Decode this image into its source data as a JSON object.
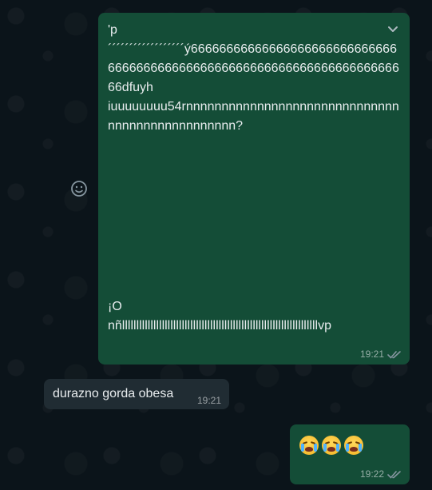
{
  "messages": [
    {
      "direction": "outgoing",
      "text_top": "'p\n´´´´´´´´´´´´´´´´´´ý666666666666666666666666666666666666666666666666666666666666666666666666dfuyh\niuuuuuuuu54rnnnnnnnnnnnnnnnnnnnnnnnnnnnnnnnnnnnnnnnnnnnnnnnn?",
      "text_bottom": "¡O\nnñlllllllllllllllllllllllllllllllllllllllllllllllllllllllllllllllllllllvp",
      "time": "19:21",
      "ticks": "double-check-icon"
    },
    {
      "direction": "incoming",
      "text": "durazno gorda obesa",
      "time": "19:21"
    },
    {
      "direction": "outgoing",
      "text": "😭😭😭",
      "time": "19:22",
      "ticks": "double-check-icon"
    }
  ],
  "colors": {
    "background": "#0b141a",
    "outgoing_bubble": "#144d37",
    "incoming_bubble": "#202c33",
    "text": "#e9edef",
    "meta": "#8696a0"
  }
}
